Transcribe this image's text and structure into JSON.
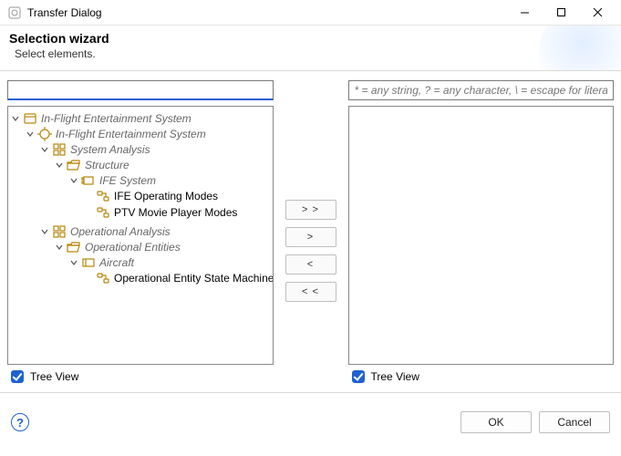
{
  "window": {
    "title": "Transfer Dialog"
  },
  "wizard": {
    "title": "Selection wizard",
    "subtitle": "Select elements."
  },
  "left": {
    "filter_value": "",
    "filter_placeholder": "",
    "checkbox_label": "Tree View",
    "checkbox_checked": true,
    "tree": {
      "label": "In-Flight Entertainment System",
      "icon": "product-icon",
      "children": [
        {
          "label": "In-Flight Entertainment System",
          "icon": "engineering-icon",
          "children": [
            {
              "label": "System Analysis",
              "icon": "grid-icon",
              "children": [
                {
                  "label": "Structure",
                  "icon": "folder-open-icon",
                  "children": [
                    {
                      "label": "IFE System",
                      "icon": "component-icon",
                      "children": [
                        {
                          "label": "IFE Operating Modes",
                          "icon": "state-machine-icon",
                          "leaf": true
                        },
                        {
                          "label": "PTV Movie Player Modes",
                          "icon": "state-machine-icon",
                          "leaf": true
                        }
                      ]
                    }
                  ]
                }
              ]
            },
            {
              "label": "Operational Analysis",
              "icon": "grid-icon",
              "children": [
                {
                  "label": "Operational Entities",
                  "icon": "folder-open-icon",
                  "children": [
                    {
                      "label": "Aircraft",
                      "icon": "entity-icon",
                      "children": [
                        {
                          "label": "Operational Entity State Machine",
                          "icon": "state-machine-icon",
                          "leaf": true
                        }
                      ]
                    }
                  ]
                }
              ]
            }
          ]
        }
      ]
    }
  },
  "right": {
    "filter_value": "",
    "filter_placeholder": "* = any string, ? = any character, \\ = escape for literals: *?\\",
    "checkbox_label": "Tree View",
    "checkbox_checked": true
  },
  "buttons": {
    "add_all": "> >",
    "add": ">",
    "remove": "<",
    "remove_all": "< <"
  },
  "footer": {
    "help_glyph": "?",
    "ok": "OK",
    "cancel": "Cancel"
  }
}
